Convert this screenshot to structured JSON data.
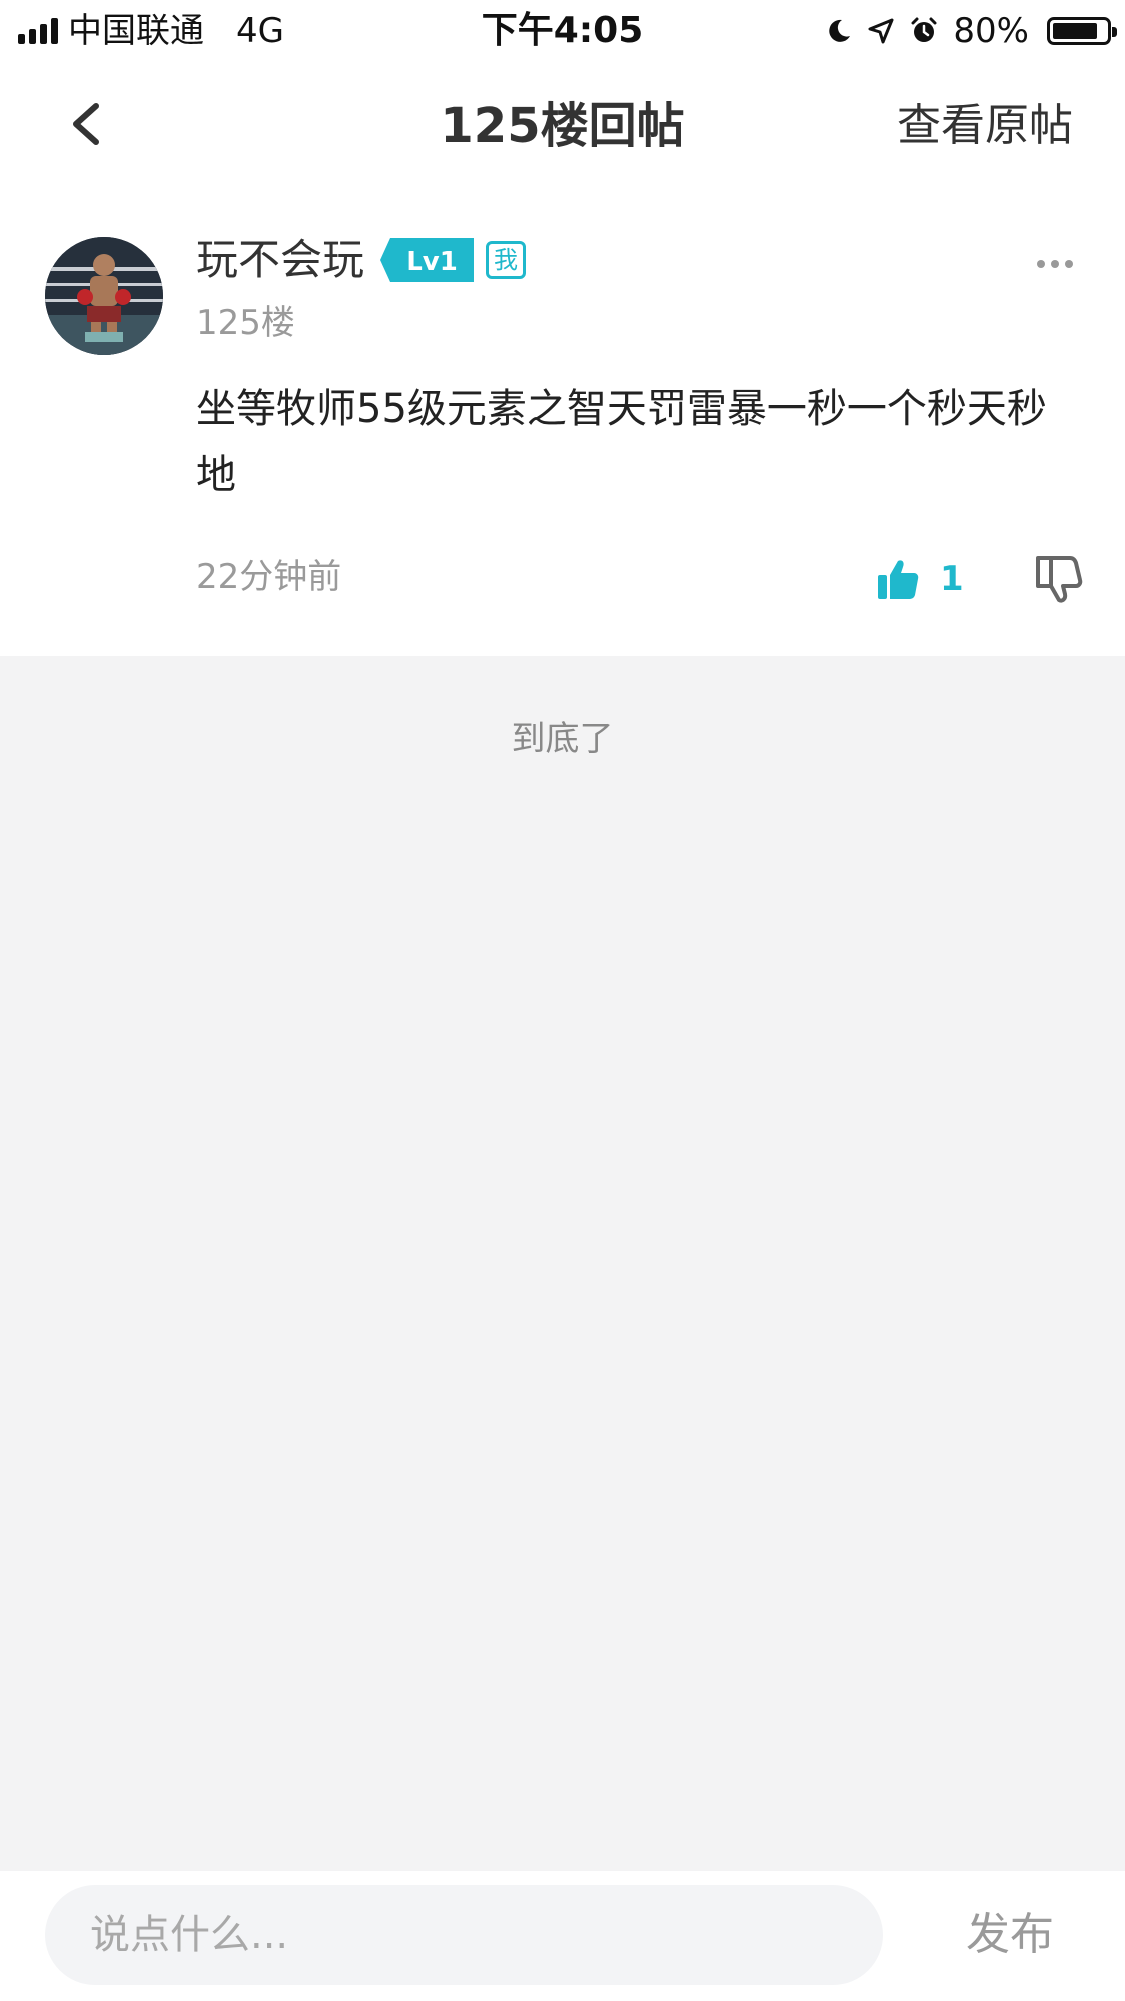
{
  "status_bar": {
    "carrier": "中国联通",
    "network": "4G",
    "time": "下午4:05",
    "battery": "80%",
    "icons": [
      "signal-icon",
      "moon-icon",
      "location-icon",
      "alarm-icon",
      "battery-icon"
    ]
  },
  "nav": {
    "back_icon": "chevron-left-icon",
    "title": "125楼回帖",
    "action": "查看原帖"
  },
  "post": {
    "username": "玩不会玩",
    "level": "Lv1",
    "me_tag": "我",
    "floor": "125楼",
    "content": "坐等牧师55级元素之智天罚雷暴一秒一个秒天秒地",
    "time": "22分钟前",
    "like_count": "1",
    "more_icon": "more-dots-icon",
    "like_icon": "thumbs-up-icon",
    "dislike_icon": "thumbs-down-icon"
  },
  "end_text": "到底了",
  "composer": {
    "placeholder": "说点什么...",
    "publish_label": "发布"
  },
  "colors": {
    "accent": "#1fb8cc",
    "background": "#f3f3f4",
    "muted_text": "#9a9a9a"
  }
}
